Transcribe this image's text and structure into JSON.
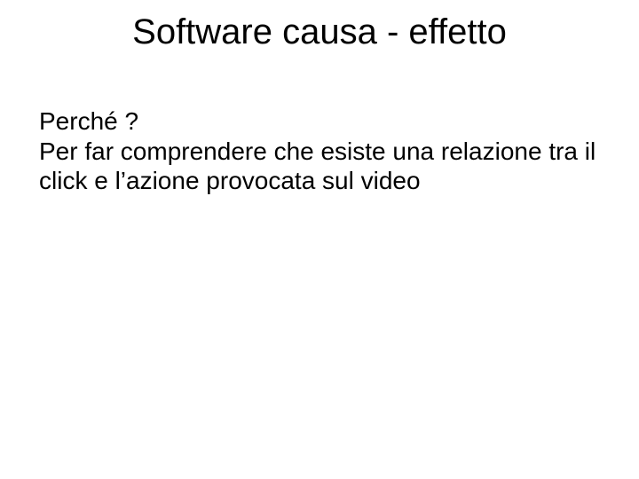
{
  "slide": {
    "title": "Software causa -  effetto",
    "body_lines": [
      "Perché ?",
      "Per far comprendere che esiste una relazione tra il click e l’azione provocata sul video"
    ]
  }
}
